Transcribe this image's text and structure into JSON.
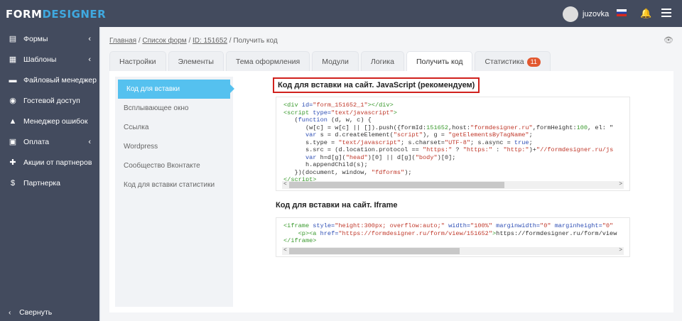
{
  "header": {
    "logo_a": "FORM",
    "logo_b": "DESIGNER",
    "username": "juzovka"
  },
  "sidebar": {
    "items": [
      {
        "label": "Формы",
        "icon": "form-icon",
        "g": "▤",
        "chev": true
      },
      {
        "label": "Шаблоны",
        "icon": "template-icon",
        "g": "▦",
        "chev": true
      },
      {
        "label": "Файловый менеджер",
        "icon": "folder-icon",
        "g": "▬",
        "chev": false
      },
      {
        "label": "Гостевой доступ",
        "icon": "user-circle-icon",
        "g": "◉",
        "chev": false
      },
      {
        "label": "Менеджер ошибок",
        "icon": "warning-icon",
        "g": "▲",
        "chev": false
      },
      {
        "label": "Оплата",
        "icon": "wallet-icon",
        "g": "▣",
        "chev": true
      },
      {
        "label": "Акции от партнеров",
        "icon": "gift-icon",
        "g": "✚",
        "chev": false
      },
      {
        "label": "Партнерка",
        "icon": "dollar-icon",
        "g": "$",
        "chev": false
      }
    ],
    "collapse": "Свернуть"
  },
  "breadcrumb": {
    "home": "Главная",
    "list": "Список форм",
    "id": "ID: 151652",
    "current": "Получить код"
  },
  "tabs": [
    "Настройки",
    "Элементы",
    "Тема оформления",
    "Модули",
    "Логика",
    "Получить код",
    "Статистика"
  ],
  "stats_badge": "11",
  "menu": [
    "Код для вставки",
    "Всплывающее окно",
    "Ссылка",
    "Wordpress",
    "Сообщество Вконтакте",
    "Код для вставки статистики"
  ],
  "section1_title": "Код для вставки на сайт. JavaScript (рекомендуем)",
  "section2_title": "Код для вставки на сайт. Iframe",
  "code1": [
    [
      [
        "tg",
        "<div "
      ],
      [
        "at",
        "id="
      ],
      [
        "st",
        "\"form_151652_1\""
      ],
      [
        "tg",
        "></div>"
      ]
    ],
    [
      [
        "tg",
        "<script "
      ],
      [
        "at",
        "type="
      ],
      [
        "st",
        "\"text/javascript\""
      ],
      [
        "tg",
        ">"
      ]
    ],
    [
      [
        "",
        "   ("
      ],
      [
        "kw",
        "function"
      ],
      [
        "",
        " (d, w, c) {"
      ]
    ],
    [
      [
        "",
        "      (w[c] = w[c] || []).push({formId:"
      ],
      [
        "nm",
        "151652"
      ],
      [
        "",
        ",host:"
      ],
      [
        "st",
        "\"formdesigner.ru\""
      ],
      [
        "",
        ",formHeight:"
      ],
      [
        "nm",
        "100"
      ],
      [
        "",
        ", el: \""
      ]
    ],
    [
      [
        "",
        "      "
      ],
      [
        "kw",
        "var"
      ],
      [
        "",
        " s = d.createElement("
      ],
      [
        "st",
        "\"script\""
      ],
      [
        "",
        "), g = "
      ],
      [
        "st",
        "\"getElementsByTagName\""
      ],
      [
        "",
        ";"
      ]
    ],
    [
      [
        "",
        "      s.type = "
      ],
      [
        "st",
        "\"text/javascript\""
      ],
      [
        "",
        "; s.charset="
      ],
      [
        "st",
        "\"UTF-8\""
      ],
      [
        "",
        "; s.async = "
      ],
      [
        "kw",
        "true"
      ],
      [
        "",
        ";"
      ]
    ],
    [
      [
        "",
        "      s.src = (d.location.protocol == "
      ],
      [
        "st",
        "\"https:\""
      ],
      [
        "",
        " ? "
      ],
      [
        "st",
        "\"https:\""
      ],
      [
        "",
        " : "
      ],
      [
        "st",
        "\"http:\""
      ],
      [
        "",
        ")+"
      ],
      [
        "st",
        "\"//formdesigner.ru/js"
      ]
    ],
    [
      [
        "",
        "      "
      ],
      [
        "kw",
        "var"
      ],
      [
        "",
        " h=d[g]("
      ],
      [
        "st",
        "\"head\""
      ],
      [
        "",
        ")[0] || d[g]("
      ],
      [
        "st",
        "\"body\""
      ],
      [
        "",
        ")[0];"
      ]
    ],
    [
      [
        "",
        "      h.appendChild(s);"
      ]
    ],
    [
      [
        "",
        "   })(document, window, "
      ],
      [
        "st",
        "\"fdforms\""
      ],
      [
        "",
        ");"
      ]
    ],
    [
      [
        "tg",
        "</script>"
      ]
    ]
  ],
  "code2": [
    [
      [
        "tg",
        "<iframe "
      ],
      [
        "at",
        "style="
      ],
      [
        "st",
        "\"height:300px; overflow:auto;\""
      ],
      [
        "at",
        " width="
      ],
      [
        "st",
        "\"100%\""
      ],
      [
        "at",
        " marginwidth="
      ],
      [
        "st",
        "\"0\""
      ],
      [
        "at",
        " marginheight="
      ],
      [
        "st",
        "\"0\""
      ]
    ],
    [
      [
        "",
        "    "
      ],
      [
        "tg",
        "<p><a "
      ],
      [
        "at",
        "href="
      ],
      [
        "st",
        "\"https://formdesigner.ru/form/view/151652\""
      ],
      [
        "tg",
        ">"
      ],
      [
        "",
        "https://formdesigner.ru/form/view"
      ]
    ],
    [
      [
        "tg",
        "</iframe>"
      ]
    ]
  ]
}
